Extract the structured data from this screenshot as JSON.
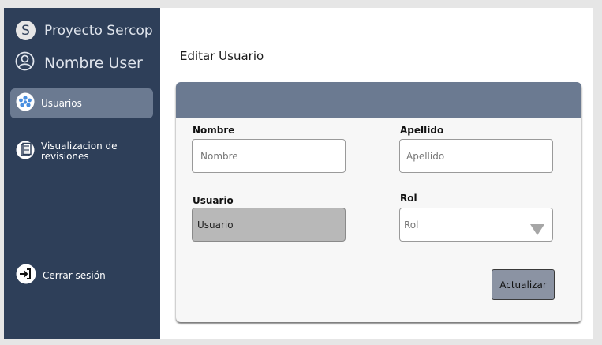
{
  "sidebar": {
    "brand": {
      "initial": "S",
      "name": "Proyecto Sercop",
      "logo_icon": "letter-s-circle"
    },
    "user": {
      "name": "Nombre User",
      "icon": "user-circle-icon"
    },
    "items": [
      {
        "label": "Usuarios",
        "icon": "users-group-icon",
        "active": true
      },
      {
        "label": "Visualizacion de revisiones",
        "icon": "document-icon",
        "active": false
      }
    ],
    "logout": {
      "label": "Cerrar sesión",
      "icon": "logout-icon"
    }
  },
  "main": {
    "title": "Editar Usuario",
    "form": {
      "nombre": {
        "label": "Nombre",
        "placeholder": "Nombre",
        "value": ""
      },
      "apellido": {
        "label": "Apellido",
        "placeholder": "Apellido",
        "value": ""
      },
      "usuario": {
        "label": "Usuario",
        "value": "Usuario",
        "disabled": true
      },
      "rol": {
        "label": "Rol",
        "value": "Rol"
      },
      "submit_label": "Actualizar"
    }
  },
  "colors": {
    "sidebar_bg": "#2e3f59",
    "active_item_bg": "#6b7a91",
    "card_header": "#6b7a91",
    "button_bg": "#8b93a3",
    "disabled_input": "#b8b8b8",
    "page_bg": "#e6e6e6"
  }
}
